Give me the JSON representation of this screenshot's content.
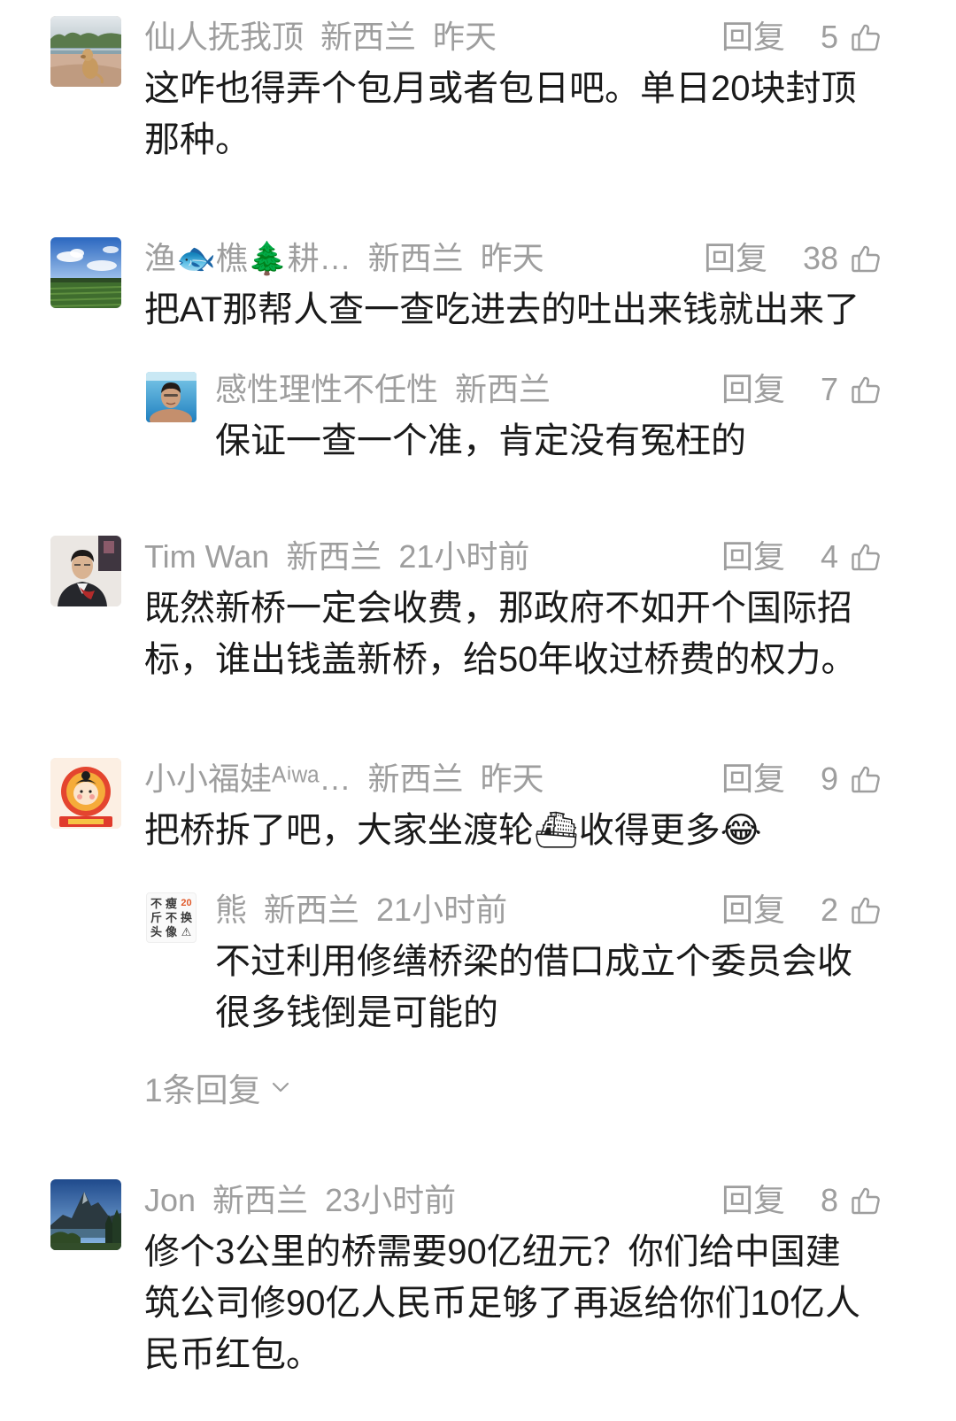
{
  "colors": {
    "background": "#ffffff",
    "meta_text": "#9e9e9e",
    "body_text": "#1a1a1a",
    "avatar_highlight": "#e05a2b"
  },
  "icons": {
    "like": "thumbs-up-icon",
    "expand": "chevron-down-icon"
  },
  "comments": [
    {
      "user": "仙人抚我顶",
      "location": "新西兰",
      "time": "昨天",
      "reply_label": "回复",
      "likes": 5,
      "text": "这咋也得弄个包月或者包日吧。单日20块封顶那种。"
    },
    {
      "user": "渔🐟樵🌲耕…",
      "location": "新西兰",
      "time": "昨天",
      "reply_label": "回复",
      "likes": 38,
      "text": "把AT那帮人查一查吃进去的吐出来钱就出来了",
      "replies": [
        {
          "user": "感性理性不任性",
          "location": "新西兰",
          "reply_label": "回复",
          "likes": 7,
          "text": "保证一查一个准，肯定没有冤枉的"
        }
      ]
    },
    {
      "user": "Tim Wan",
      "location": "新西兰",
      "time": "21小时前",
      "reply_label": "回复",
      "likes": 4,
      "text": "既然新桥一定会收费，那政府不如开个国际招标，谁出钱盖新桥，给50年收过桥费的权力。"
    },
    {
      "user": "小小福娃ᴬⁱʷᵃ…",
      "location": "新西兰",
      "time": "昨天",
      "reply_label": "回复",
      "likes": 9,
      "text": "把桥拆了吧，大家坐渡轮⛴收得更多😂",
      "replies": [
        {
          "user": "熊",
          "avatar_text": [
            "不",
            "瘦",
            "20",
            "斤",
            "不",
            "换",
            "头",
            "像",
            "⚠"
          ],
          "location": "新西兰",
          "time": "21小时前",
          "reply_label": "回复",
          "likes": 2,
          "text": "不过利用修缮桥梁的借口成立个委员会收很多钱倒是可能的"
        }
      ],
      "more_replies": "1条回复"
    },
    {
      "user": "Jon",
      "location": "新西兰",
      "time": "23小时前",
      "reply_label": "回复",
      "likes": 8,
      "text": "修个3公里的桥需要90亿纽元？你们给中国建筑公司修90亿人民币足够了再返给你们10亿人民币红包。"
    }
  ]
}
